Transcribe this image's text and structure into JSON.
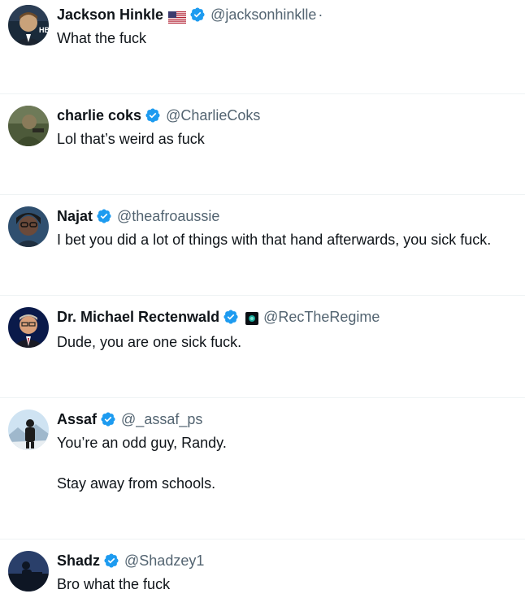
{
  "tweets": [
    {
      "name": "Jackson Hinkle",
      "handle": "@jacksonhinklle",
      "separator": "·",
      "text": "What the fuck",
      "flag": "us-flag",
      "verified": true,
      "avatar_colors": [
        "#1a2a3a",
        "#c9a27a"
      ]
    },
    {
      "name": "charlie coks",
      "handle": "@CharlieCoks",
      "text": "Lol that’s weird as fuck",
      "verified": true,
      "avatar_colors": [
        "#4d5a3a",
        "#8a7b5a"
      ]
    },
    {
      "name": "Najat",
      "handle": "@theafroaussie",
      "text": "I bet you did a lot of things with that hand afterwards, you sick fuck.",
      "verified": true,
      "avatar_colors": [
        "#2f4f6f",
        "#6b4a3a"
      ]
    },
    {
      "name": "Dr. Michael Rectenwald",
      "handle": "@RecTheRegime",
      "text": "Dude, you are one sick fuck.",
      "verified": true,
      "affiliate": true,
      "avatar_colors": [
        "#0a1a4a",
        "#d9a07a"
      ]
    },
    {
      "name": "Assaf",
      "handle": "@_assaf_ps",
      "text": "You’re an odd guy, Randy.",
      "text_line2": "Stay away from schools.",
      "verified": true,
      "avatar_colors": [
        "#cfe3f2",
        "#1c1c1c"
      ]
    },
    {
      "name": "Shadz",
      "handle": "@Shadzey1",
      "text": "Bro what the fuck",
      "verified": true,
      "avatar_colors": [
        "#2a3f6a",
        "#0e1624"
      ]
    }
  ],
  "colors": {
    "verified_blue": "#1d9bf0",
    "handle_gray": "#536471",
    "divider": "#eff3f4"
  }
}
